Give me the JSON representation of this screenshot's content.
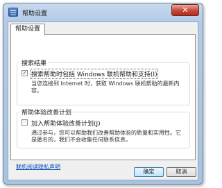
{
  "window": {
    "title": "帮助设置",
    "close_glyph": "✕"
  },
  "tabs": [
    {
      "label": "帮助设置"
    }
  ],
  "search_results": {
    "group_title": "搜索结果",
    "checkbox_label": "搜索帮助时包括 Windows 联机帮助和支持(I)",
    "checked": true,
    "check_glyph": "✓",
    "description": "当您连接到 Internet 时，获取 Windows 联机帮助的最新内容。"
  },
  "improvement": {
    "group_title": "帮助体验改善计划",
    "checkbox_label": "加入帮助体验改善计划(J)",
    "checked": false,
    "description": "通过参与，您可以帮助我们改善帮助体验的质量和实用性。它是匿名的，我们不会收集任何联系信息。"
  },
  "privacy_link": "联机阅读隐私声明",
  "buttons": {
    "ok": "确定",
    "cancel": "取消"
  },
  "colors": {
    "window_frame": "#b4cbe5",
    "link": "#0a4fb5",
    "close_button": "#c6473a"
  }
}
